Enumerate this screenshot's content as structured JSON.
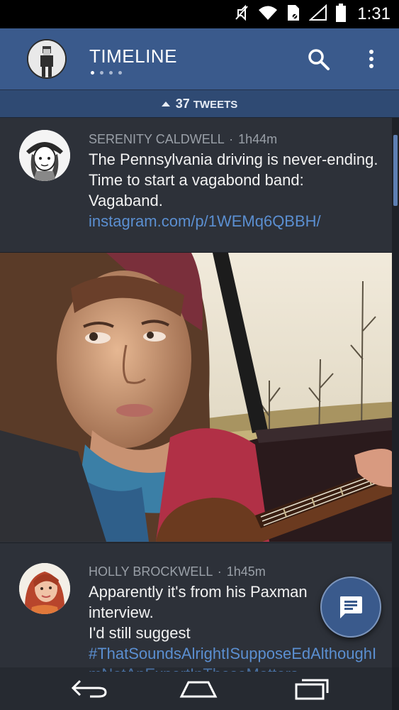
{
  "status_bar": {
    "time": "1:31",
    "icons": [
      "mute-icon",
      "wifi-icon",
      "sim-icon",
      "signal-icon",
      "battery-icon"
    ]
  },
  "app_bar": {
    "title": "TIMELINE",
    "page_count": 4,
    "active_page": 1
  },
  "new_tweets": {
    "count": "37",
    "label": "TWEETS"
  },
  "tweets": [
    {
      "author": "SERENITY CALDWELL",
      "separator": "·",
      "time": "1h44m",
      "text_before": "The Pennsylvania driving is never-ending. Time to start a vagabond band: Vagaband. ",
      "link": "instagram.com/p/1WEMq6QBBH/",
      "has_photo": true
    },
    {
      "author": "HOLLY BROCKWELL",
      "separator": "·",
      "time": "1h45m",
      "line1": "Apparently it's from his Paxman",
      "line2": "interview.",
      "line3": "I'd still suggest",
      "hashtag": "#ThatSoundsAlrightISupposeEdAlthoughImNotAnExpertInTheseMatters"
    }
  ],
  "colors": {
    "app_bar": "#3a5a8c",
    "link": "#5b8fd1",
    "background": "#2d3139"
  }
}
